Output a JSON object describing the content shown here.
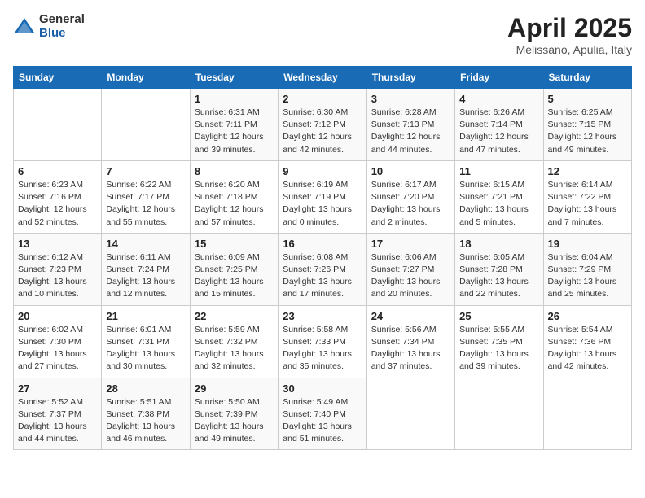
{
  "logo": {
    "general": "General",
    "blue": "Blue"
  },
  "title": "April 2025",
  "subtitle": "Melissano, Apulia, Italy",
  "days_of_week": [
    "Sunday",
    "Monday",
    "Tuesday",
    "Wednesday",
    "Thursday",
    "Friday",
    "Saturday"
  ],
  "weeks": [
    [
      {
        "day": "",
        "detail": ""
      },
      {
        "day": "",
        "detail": ""
      },
      {
        "day": "1",
        "detail": "Sunrise: 6:31 AM\nSunset: 7:11 PM\nDaylight: 12 hours\nand 39 minutes."
      },
      {
        "day": "2",
        "detail": "Sunrise: 6:30 AM\nSunset: 7:12 PM\nDaylight: 12 hours\nand 42 minutes."
      },
      {
        "day": "3",
        "detail": "Sunrise: 6:28 AM\nSunset: 7:13 PM\nDaylight: 12 hours\nand 44 minutes."
      },
      {
        "day": "4",
        "detail": "Sunrise: 6:26 AM\nSunset: 7:14 PM\nDaylight: 12 hours\nand 47 minutes."
      },
      {
        "day": "5",
        "detail": "Sunrise: 6:25 AM\nSunset: 7:15 PM\nDaylight: 12 hours\nand 49 minutes."
      }
    ],
    [
      {
        "day": "6",
        "detail": "Sunrise: 6:23 AM\nSunset: 7:16 PM\nDaylight: 12 hours\nand 52 minutes."
      },
      {
        "day": "7",
        "detail": "Sunrise: 6:22 AM\nSunset: 7:17 PM\nDaylight: 12 hours\nand 55 minutes."
      },
      {
        "day": "8",
        "detail": "Sunrise: 6:20 AM\nSunset: 7:18 PM\nDaylight: 12 hours\nand 57 minutes."
      },
      {
        "day": "9",
        "detail": "Sunrise: 6:19 AM\nSunset: 7:19 PM\nDaylight: 13 hours\nand 0 minutes."
      },
      {
        "day": "10",
        "detail": "Sunrise: 6:17 AM\nSunset: 7:20 PM\nDaylight: 13 hours\nand 2 minutes."
      },
      {
        "day": "11",
        "detail": "Sunrise: 6:15 AM\nSunset: 7:21 PM\nDaylight: 13 hours\nand 5 minutes."
      },
      {
        "day": "12",
        "detail": "Sunrise: 6:14 AM\nSunset: 7:22 PM\nDaylight: 13 hours\nand 7 minutes."
      }
    ],
    [
      {
        "day": "13",
        "detail": "Sunrise: 6:12 AM\nSunset: 7:23 PM\nDaylight: 13 hours\nand 10 minutes."
      },
      {
        "day": "14",
        "detail": "Sunrise: 6:11 AM\nSunset: 7:24 PM\nDaylight: 13 hours\nand 12 minutes."
      },
      {
        "day": "15",
        "detail": "Sunrise: 6:09 AM\nSunset: 7:25 PM\nDaylight: 13 hours\nand 15 minutes."
      },
      {
        "day": "16",
        "detail": "Sunrise: 6:08 AM\nSunset: 7:26 PM\nDaylight: 13 hours\nand 17 minutes."
      },
      {
        "day": "17",
        "detail": "Sunrise: 6:06 AM\nSunset: 7:27 PM\nDaylight: 13 hours\nand 20 minutes."
      },
      {
        "day": "18",
        "detail": "Sunrise: 6:05 AM\nSunset: 7:28 PM\nDaylight: 13 hours\nand 22 minutes."
      },
      {
        "day": "19",
        "detail": "Sunrise: 6:04 AM\nSunset: 7:29 PM\nDaylight: 13 hours\nand 25 minutes."
      }
    ],
    [
      {
        "day": "20",
        "detail": "Sunrise: 6:02 AM\nSunset: 7:30 PM\nDaylight: 13 hours\nand 27 minutes."
      },
      {
        "day": "21",
        "detail": "Sunrise: 6:01 AM\nSunset: 7:31 PM\nDaylight: 13 hours\nand 30 minutes."
      },
      {
        "day": "22",
        "detail": "Sunrise: 5:59 AM\nSunset: 7:32 PM\nDaylight: 13 hours\nand 32 minutes."
      },
      {
        "day": "23",
        "detail": "Sunrise: 5:58 AM\nSunset: 7:33 PM\nDaylight: 13 hours\nand 35 minutes."
      },
      {
        "day": "24",
        "detail": "Sunrise: 5:56 AM\nSunset: 7:34 PM\nDaylight: 13 hours\nand 37 minutes."
      },
      {
        "day": "25",
        "detail": "Sunrise: 5:55 AM\nSunset: 7:35 PM\nDaylight: 13 hours\nand 39 minutes."
      },
      {
        "day": "26",
        "detail": "Sunrise: 5:54 AM\nSunset: 7:36 PM\nDaylight: 13 hours\nand 42 minutes."
      }
    ],
    [
      {
        "day": "27",
        "detail": "Sunrise: 5:52 AM\nSunset: 7:37 PM\nDaylight: 13 hours\nand 44 minutes."
      },
      {
        "day": "28",
        "detail": "Sunrise: 5:51 AM\nSunset: 7:38 PM\nDaylight: 13 hours\nand 46 minutes."
      },
      {
        "day": "29",
        "detail": "Sunrise: 5:50 AM\nSunset: 7:39 PM\nDaylight: 13 hours\nand 49 minutes."
      },
      {
        "day": "30",
        "detail": "Sunrise: 5:49 AM\nSunset: 7:40 PM\nDaylight: 13 hours\nand 51 minutes."
      },
      {
        "day": "",
        "detail": ""
      },
      {
        "day": "",
        "detail": ""
      },
      {
        "day": "",
        "detail": ""
      }
    ]
  ]
}
